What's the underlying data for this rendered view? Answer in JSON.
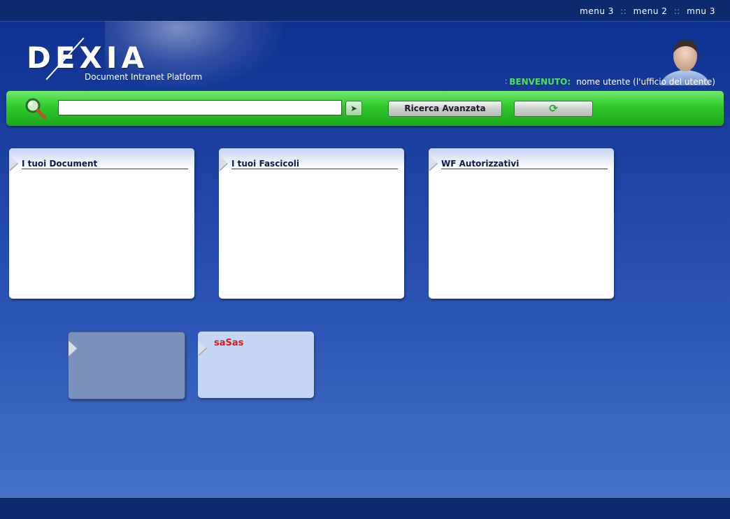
{
  "top_menu": {
    "items": [
      "menu 3",
      "menu 2",
      "mnu 3"
    ],
    "separator": "::"
  },
  "brand": {
    "logo": "DEXIA",
    "subtitle": "Document Intranet Platform"
  },
  "user": {
    "welcome_label": "BENVENUTO:",
    "name": "nome utente (l'ufficio del utente)",
    "avatar_icon": "user-avatar-icon"
  },
  "search": {
    "value": "",
    "placeholder": "",
    "icon": "magnifier-icon",
    "go_icon": "arrow-right-icon",
    "advanced_label": "Ricerca Avanzata",
    "refresh_icon": "refresh-icon"
  },
  "panels": [
    {
      "title": "I tuoi Document"
    },
    {
      "title": "I tuoi Fascicoli"
    },
    {
      "title": "WF Autorizzativi"
    }
  ],
  "cards": [
    {
      "label": ""
    },
    {
      "label": "saSas"
    }
  ],
  "colors": {
    "accent_green": "#2fca2c",
    "welcome_green": "#4de05a",
    "header_navy": "#0c2a6e",
    "card_label_red": "#dd1a1a"
  }
}
